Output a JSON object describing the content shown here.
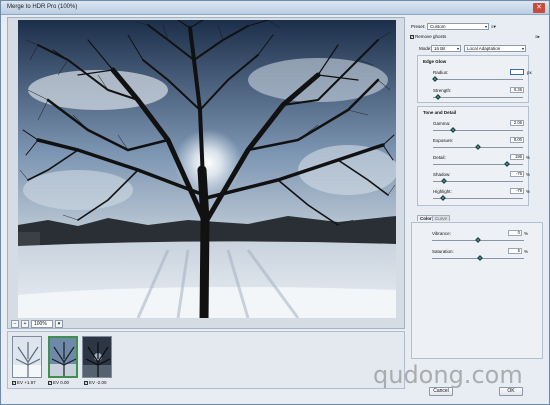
{
  "window": {
    "title": "Merge to HDR Pro (100%)"
  },
  "zoom": {
    "level": "100%"
  },
  "thumbnails": [
    {
      "label": "EV +1.97",
      "selected": false
    },
    {
      "label": "EV 0.00",
      "selected": true
    },
    {
      "label": "EV -2.00",
      "selected": false
    }
  ],
  "panel": {
    "preset_label": "Preset:",
    "preset_value": "Custom",
    "remove_ghosts_label": "Remove ghosts",
    "mode_label": "Mode:",
    "mode_value": "16 Bit",
    "method_value": "Local Adaptation",
    "edge_glow": {
      "title": "Edge Glow",
      "radius_label": "Radius:",
      "radius_value": "",
      "radius_unit": "px",
      "radius_level": 0.02,
      "strength_label": "Strength:",
      "strength_value": "0.26",
      "strength_level": 0.05
    },
    "tone_detail": {
      "title": "Tone and Detail",
      "gamma_label": "Gamma:",
      "gamma_value": "2.06",
      "gamma_level": 0.22,
      "exposure_label": "Exposure:",
      "exposure_value": "0.00",
      "exposure_level": 0.5,
      "detail_label": "Detail:",
      "detail_value": "196",
      "detail_unit": "%",
      "detail_level": 0.82,
      "shadow_label": "Shadow:",
      "shadow_value": "-76",
      "shadow_unit": "%",
      "shadow_level": 0.12,
      "highlight_label": "Highlight:",
      "highlight_value": "-79",
      "highlight_unit": "%",
      "highlight_level": 0.11
    },
    "color_tabs": {
      "color_label": "Color",
      "curve_label": "Curve"
    },
    "color": {
      "vibrance_label": "Vibrance:",
      "vibrance_value": "0",
      "vibrance_unit": "%",
      "vibrance_level": 0.5,
      "saturation_label": "Saturation:",
      "saturation_value": "5",
      "saturation_unit": "%",
      "saturation_level": 0.52
    },
    "buttons": {
      "cancel": "Cancel",
      "ok": "OK"
    }
  },
  "watermark": "qudong.com",
  "colors": {
    "accent_green": "#3fa05a",
    "selected_thumb": "#3f8f4e",
    "title_bar": "#b9cde2"
  }
}
